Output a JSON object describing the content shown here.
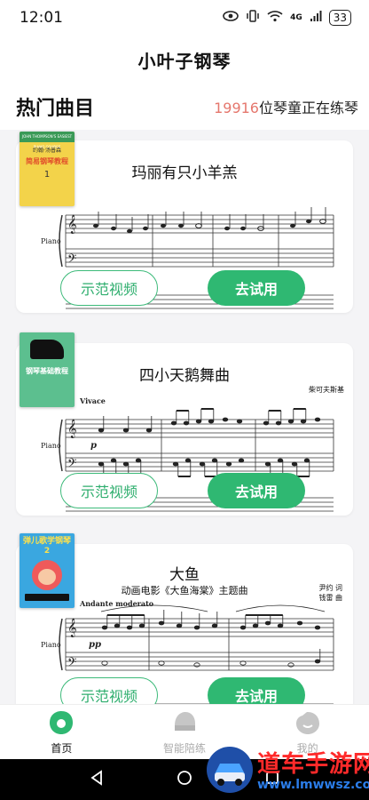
{
  "status": {
    "time": "12:01",
    "battery": "33",
    "network": "4G"
  },
  "app": {
    "title": "小叶子钢琴"
  },
  "section": {
    "title": "热门曲目",
    "practice_count": "19916",
    "practice_suffix": "位琴童正在练琴"
  },
  "songs": [
    {
      "title": "玛丽有只小羊羔",
      "instrument_label": "Piano",
      "cover": {
        "top_text": "JOHN THOMPSON'S EASIEST PIANO COURSE",
        "name_text": "约翰·汤普森",
        "title_text": "简易钢琴教程",
        "number": "1",
        "color": "#f3d34a"
      },
      "demo_label": "示范视频",
      "try_label": "去试用"
    },
    {
      "title": "四小天鹅舞曲",
      "composer": "柴可夫斯基",
      "tempo": "Vivace",
      "dynamic": "p",
      "instrument_label": "Piano",
      "cover": {
        "title_text": "钢琴基础教程",
        "color": "#5cbf8f"
      },
      "demo_label": "示范视频",
      "try_label": "去试用"
    },
    {
      "title": "大鱼",
      "subtitle": "动画电影《大鱼海棠》主题曲",
      "credits_lyric": "尹约 词",
      "credits_music": "钱雷 曲",
      "tempo": "Andante moderato",
      "dynamic": "pp",
      "instrument_label": "Piano",
      "cover": {
        "title_text": "弹儿歌学钢琴2",
        "color": "#3aa7e0"
      },
      "demo_label": "示范视频",
      "try_label": "去试用"
    }
  ],
  "tabs": [
    {
      "label": "首页",
      "icon": "home-leaf-icon",
      "active": true
    },
    {
      "label": "智能陪练",
      "icon": "smart-practice-icon",
      "active": false
    },
    {
      "label": "我的",
      "icon": "profile-icon",
      "active": false
    }
  ],
  "watermark": {
    "main": "道车手游网",
    "url": "www.lmwwsz.com"
  },
  "colors": {
    "accent": "#2fb872",
    "count": "#e5776d"
  }
}
